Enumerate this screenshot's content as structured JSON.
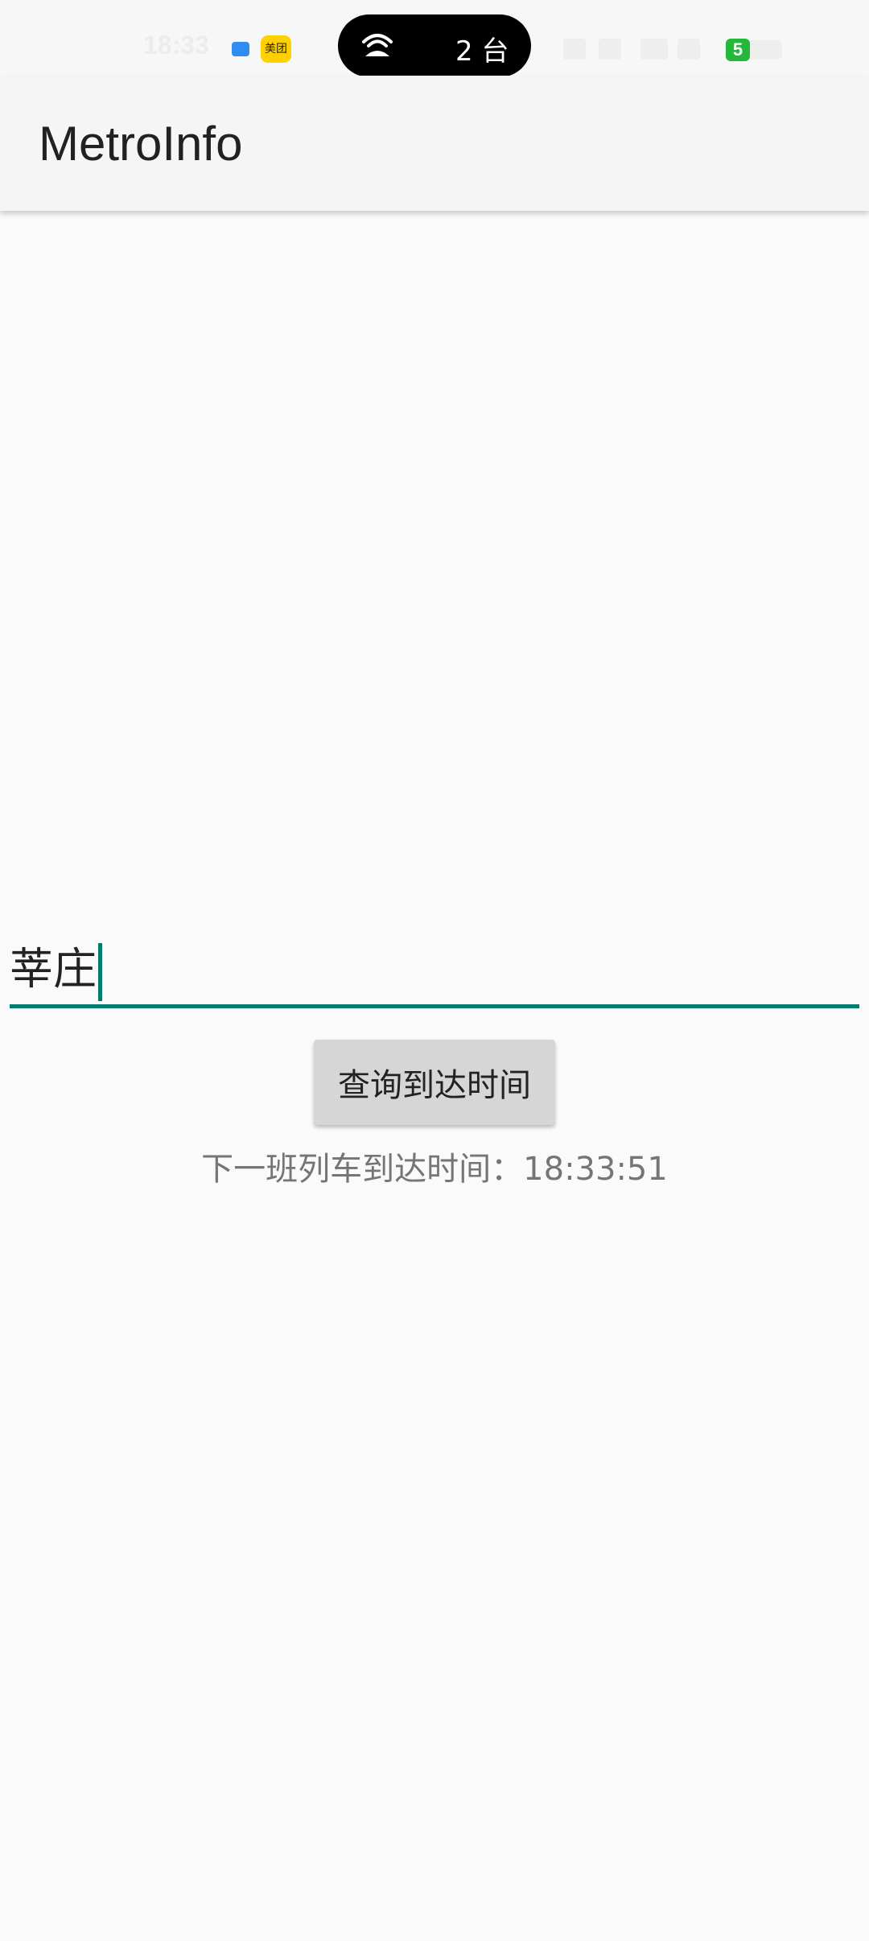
{
  "status_bar": {
    "time": "18:33",
    "meituan_label": "美团",
    "island_text": "2 台",
    "battery_level": "5"
  },
  "app_bar": {
    "title": "MetroInfo"
  },
  "station_input": {
    "value": "莘庄"
  },
  "query_button": {
    "label": "查询到达时间"
  },
  "result": {
    "text": "下一班列车到达时间：18:33:51"
  },
  "colors": {
    "accent": "#007b6d",
    "background": "#fafafa",
    "app_bar": "#f5f5f5",
    "button": "#d6d6d6",
    "battery": "#23b83a",
    "island": "#000000"
  }
}
